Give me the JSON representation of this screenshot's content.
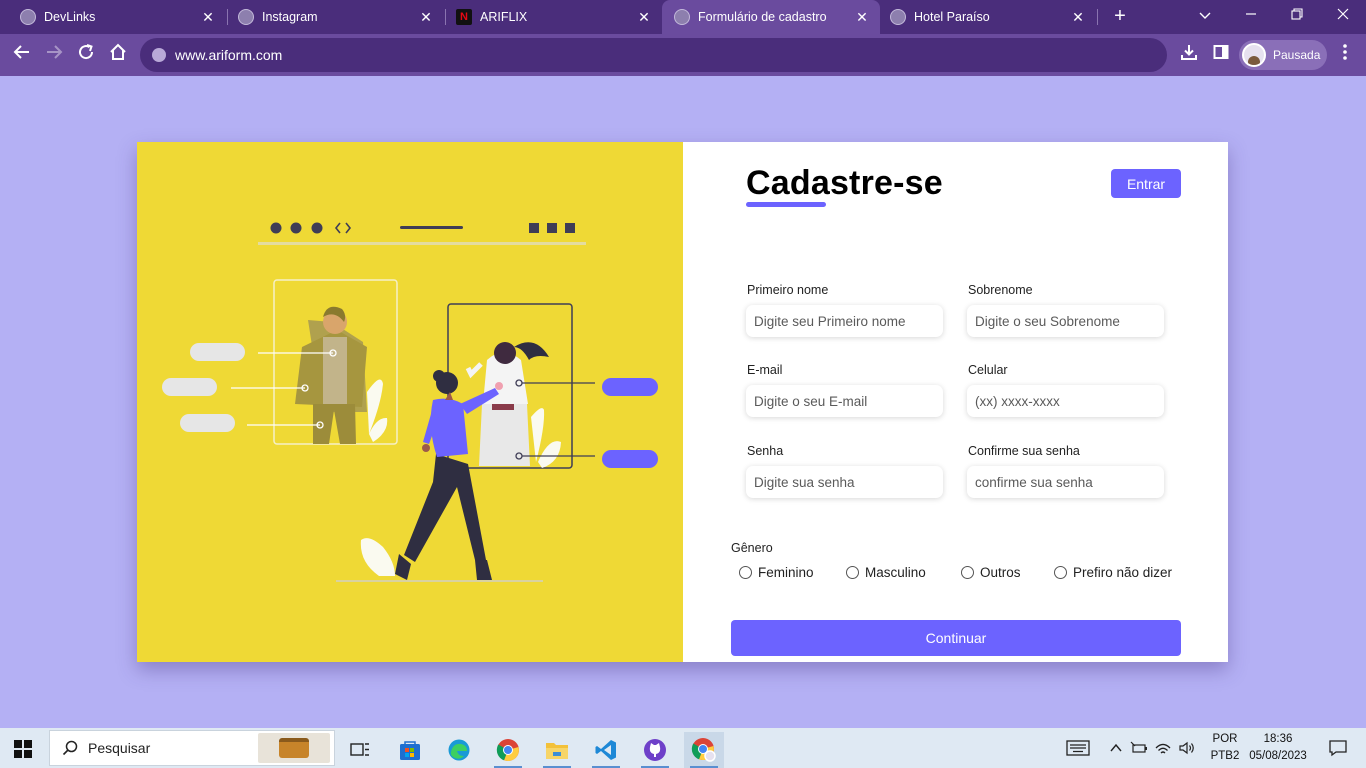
{
  "browser": {
    "tabs": [
      {
        "title": "DevLinks",
        "favicon": "globe-icon",
        "active": false
      },
      {
        "title": "Instagram",
        "favicon": "globe-icon",
        "active": false
      },
      {
        "title": "ARIFLIX",
        "favicon": "netflix-icon",
        "active": false
      },
      {
        "title": "Formulário de cadastro",
        "favicon": "globe-icon",
        "active": true
      },
      {
        "title": "Hotel Paraíso",
        "favicon": "globe-icon",
        "active": false
      }
    ],
    "close_glyph": "✕",
    "new_tab_glyph": "+",
    "url": "www.ariform.com",
    "profile_name": "Pausada",
    "netflix_glyph": "N"
  },
  "form": {
    "title": "Cadastre-se",
    "login_button": "Entrar",
    "fields": {
      "first_name": {
        "label": "Primeiro nome",
        "placeholder": "Digite seu Primeiro nome"
      },
      "last_name": {
        "label": "Sobrenome",
        "placeholder": "Digite o seu Sobrenome"
      },
      "email": {
        "label": "E-mail",
        "placeholder": "Digite o seu E-mail"
      },
      "phone": {
        "label": "Celular",
        "placeholder": "(xx) xxxx-xxxx"
      },
      "password": {
        "label": "Senha",
        "placeholder": "Digite sua senha"
      },
      "confirm_password": {
        "label": "Confirme sua senha",
        "placeholder": "confirme sua senha"
      }
    },
    "gender_label": "Gênero",
    "gender_options": [
      "Feminino",
      "Masculino",
      "Outros",
      "Prefiro não dizer"
    ],
    "continue_button": "Continuar"
  },
  "taskbar": {
    "search_placeholder": "Pesquisar",
    "language": "POR",
    "keyboard": "PTB2",
    "time": "18:36",
    "date": "05/08/2023"
  },
  "colors": {
    "accent": "#6c63ff",
    "illustration_bg": "#efd935",
    "page_bg": "#b4b0f4",
    "browser_frame": "#4a2d7b",
    "browser_toolbar": "#6a4b9e"
  }
}
